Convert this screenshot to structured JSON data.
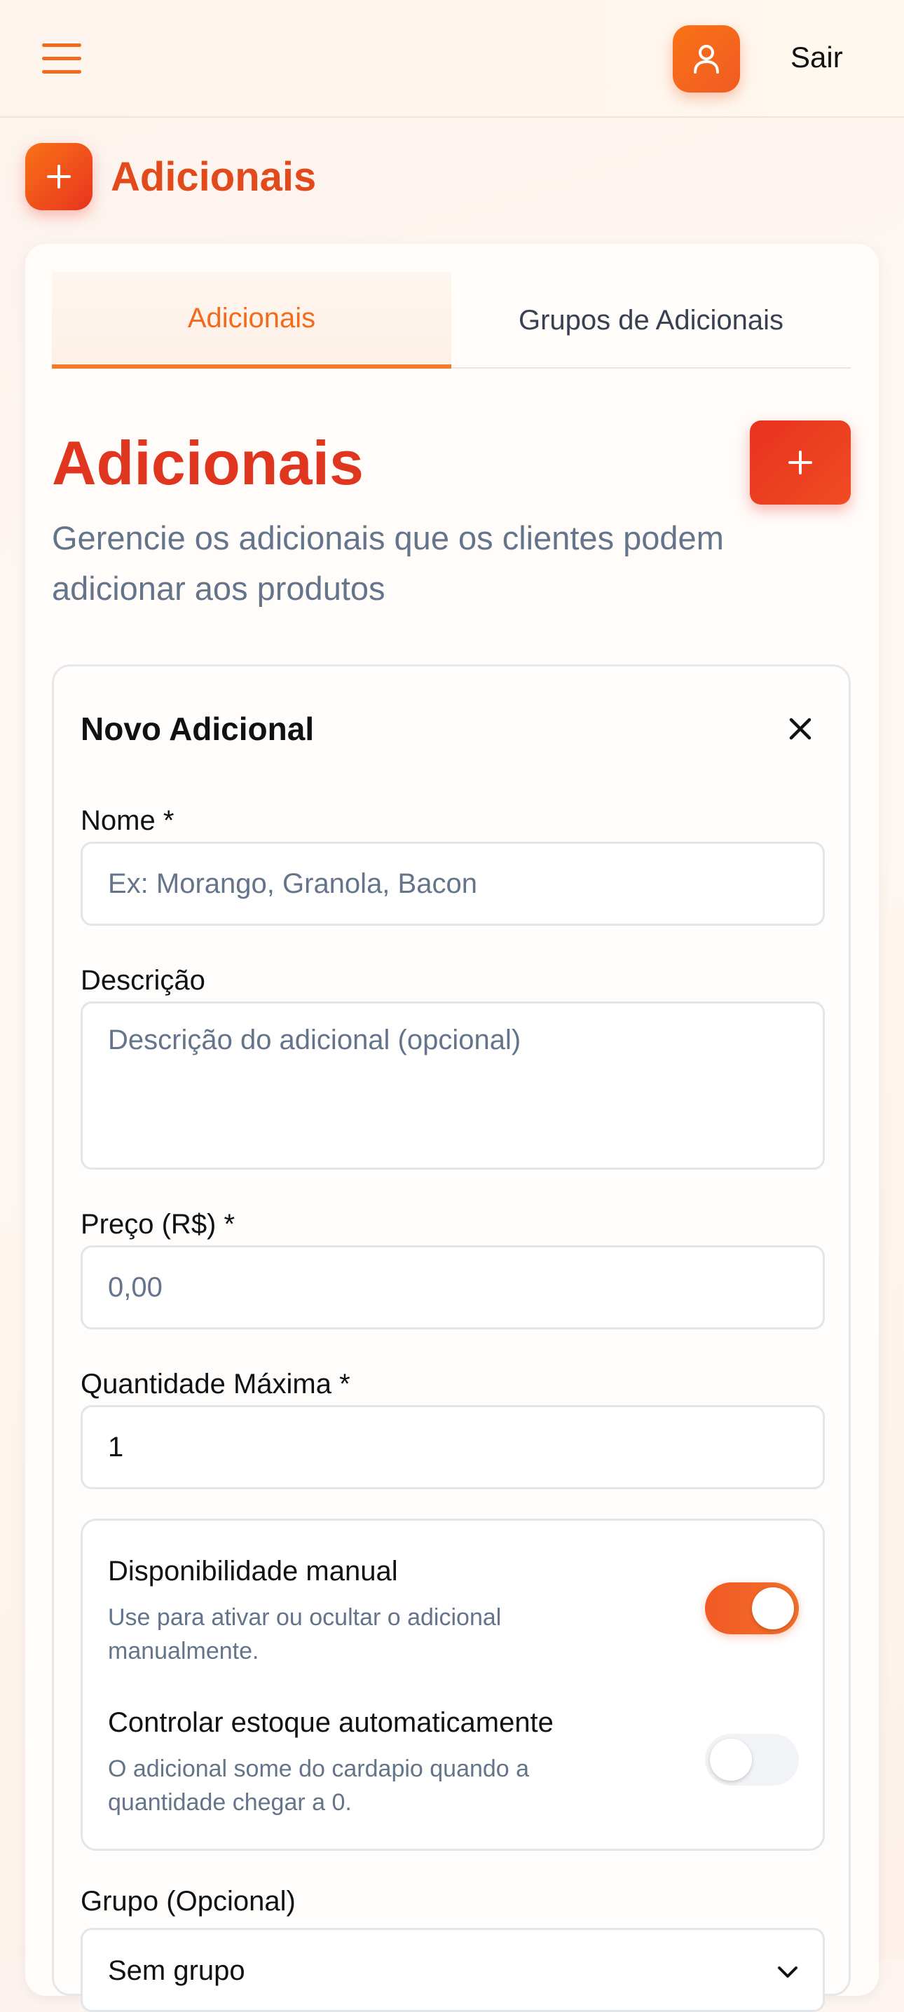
{
  "header": {
    "logout_label": "Sair",
    "menu_icon": "menu-icon",
    "user_icon": "user-icon"
  },
  "page": {
    "title": "Adicionais",
    "icon": "plus-icon"
  },
  "tabs": [
    {
      "label": "Adicionais",
      "active": true
    },
    {
      "label": "Grupos de Adicionais",
      "active": false
    }
  ],
  "section": {
    "title": "Adicionais",
    "subtitle": "Gerencie os adicionais que os clientes podem adicionar aos produtos"
  },
  "form": {
    "title": "Novo Adicional",
    "fields": {
      "name": {
        "label": "Nome *",
        "placeholder": "Ex: Morango, Granola, Bacon",
        "value": ""
      },
      "description": {
        "label": "Descrição",
        "placeholder": "Descrição do adicional (opcional)",
        "value": ""
      },
      "price": {
        "label": "Preço (R$) *",
        "placeholder": "0,00",
        "value": ""
      },
      "max_qty": {
        "label": "Quantidade Máxima *",
        "value": "1"
      }
    },
    "toggles": [
      {
        "title": "Disponibilidade manual",
        "description": "Use para ativar ou ocultar o adicional manualmente.",
        "on": true
      },
      {
        "title": "Controlar estoque automaticamente",
        "description": "O adicional some do cardapio quando a quantidade chegar a 0.",
        "on": false
      }
    ],
    "group": {
      "label": "Grupo (Opcional)",
      "selected": "Sem grupo"
    }
  },
  "colors": {
    "accent": "#f26a1b",
    "title_red": "#e0361f",
    "muted": "#64748b"
  }
}
